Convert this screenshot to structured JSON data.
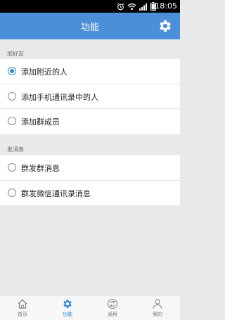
{
  "status_bar": {
    "time": "18:05",
    "icons": [
      "alarm-icon",
      "wifi-icon",
      "signal-icon",
      "battery-icon"
    ]
  },
  "header": {
    "title": "功能",
    "settings_icon": "gear-icon",
    "background_color": "#4c8fd9"
  },
  "sections": [
    {
      "header": "加好友",
      "items": [
        {
          "label": "添加附近的人",
          "selected": true
        },
        {
          "label": "添加手机通讯录中的人",
          "selected": false
        },
        {
          "label": "添加群成员",
          "selected": false
        }
      ]
    },
    {
      "header": "发消息",
      "items": [
        {
          "label": "群发群消息",
          "selected": false
        },
        {
          "label": "群发微信通讯录消息",
          "selected": false
        }
      ]
    }
  ],
  "tab_bar": {
    "active_index": 1,
    "active_color": "#2d8bd9",
    "tabs": [
      {
        "label": "首页",
        "icon": "home-icon"
      },
      {
        "label": "功能",
        "icon": "gear-icon"
      },
      {
        "label": "通用",
        "icon": "sync-icon"
      },
      {
        "label": "我的",
        "icon": "person-icon"
      }
    ]
  }
}
